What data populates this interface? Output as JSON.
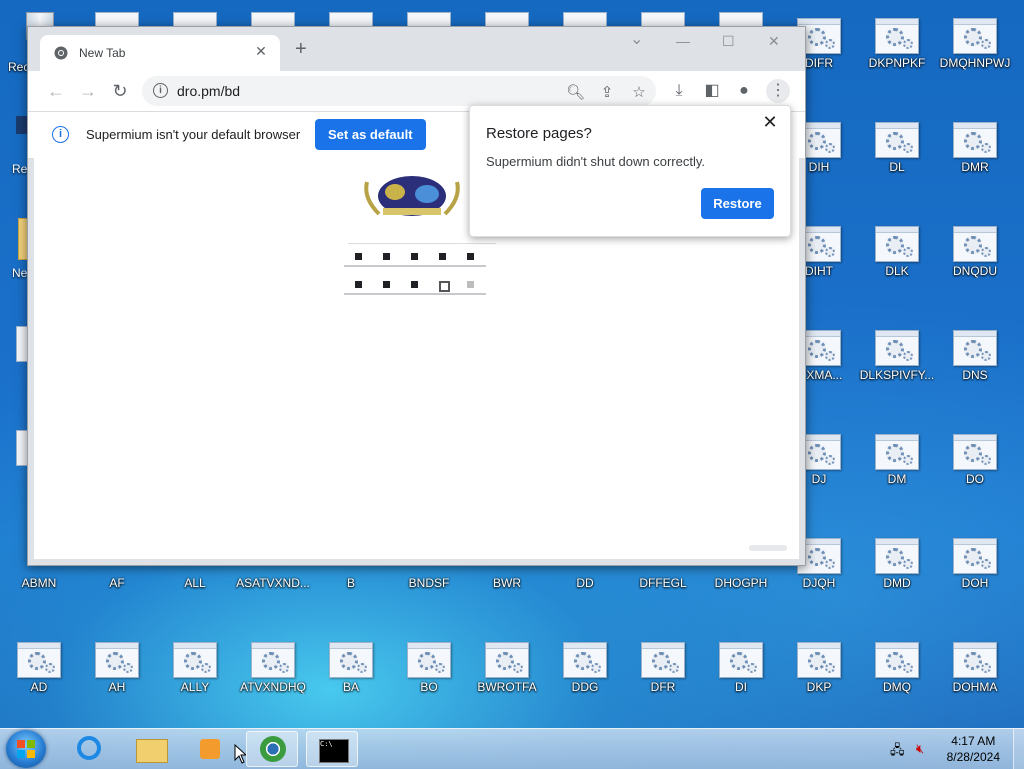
{
  "desktop": {
    "icons_right": [
      {
        "label": "DIFR"
      },
      {
        "label": "DKPNPKF"
      },
      {
        "label": "DMQHNPWJ"
      },
      {
        "label": "DIH"
      },
      {
        "label": "DL"
      },
      {
        "label": "DMR"
      },
      {
        "label": "DIHT"
      },
      {
        "label": "DLK"
      },
      {
        "label": "DNQDU"
      },
      {
        "label": "ITXMA..."
      },
      {
        "label": "DLKSPIVFY..."
      },
      {
        "label": "DNS"
      },
      {
        "label": "DJ"
      },
      {
        "label": "DM"
      },
      {
        "label": "DO"
      },
      {
        "label": "DJQH"
      },
      {
        "label": "DMD"
      },
      {
        "label": "DOH"
      }
    ],
    "row6": [
      {
        "label": "ABMN"
      },
      {
        "label": "AF"
      },
      {
        "label": "ALL"
      },
      {
        "label": "ASATVXND..."
      },
      {
        "label": "B"
      },
      {
        "label": "BNDSF"
      },
      {
        "label": "BWR"
      },
      {
        "label": "DD"
      },
      {
        "label": "DFFEGL"
      },
      {
        "label": "DHOGPH"
      }
    ],
    "row7": [
      {
        "label": "AD"
      },
      {
        "label": "AH"
      },
      {
        "label": "ALLY"
      },
      {
        "label": "ATVXNDHQ"
      },
      {
        "label": "BA"
      },
      {
        "label": "BO"
      },
      {
        "label": "BWROTFA"
      },
      {
        "label": "DDG"
      },
      {
        "label": "DFR"
      },
      {
        "label": "DI"
      },
      {
        "label": "DKP"
      },
      {
        "label": "DMQ"
      },
      {
        "label": "DOHMA"
      }
    ],
    "left_partial": [
      {
        "label": "Rec"
      },
      {
        "label": "Re"
      },
      {
        "label": "Ne"
      }
    ]
  },
  "browser": {
    "tab": {
      "title": "New Tab",
      "close_glyph": "✕"
    },
    "newtab_glyph": "+",
    "window_controls": {
      "dropdown": "⌄",
      "minimize": "—",
      "maximize": "☐",
      "close": "✕"
    },
    "address": "dro.pm/bd",
    "infobar": {
      "message": "Supermium isn't your default browser",
      "button": "Set as default"
    },
    "popup": {
      "title": "Restore pages?",
      "message": "Supermium didn't shut down correctly.",
      "button": "Restore",
      "close_glyph": "✕"
    }
  },
  "taskbar": {
    "time": "4:17 AM",
    "date": "8/28/2024"
  }
}
